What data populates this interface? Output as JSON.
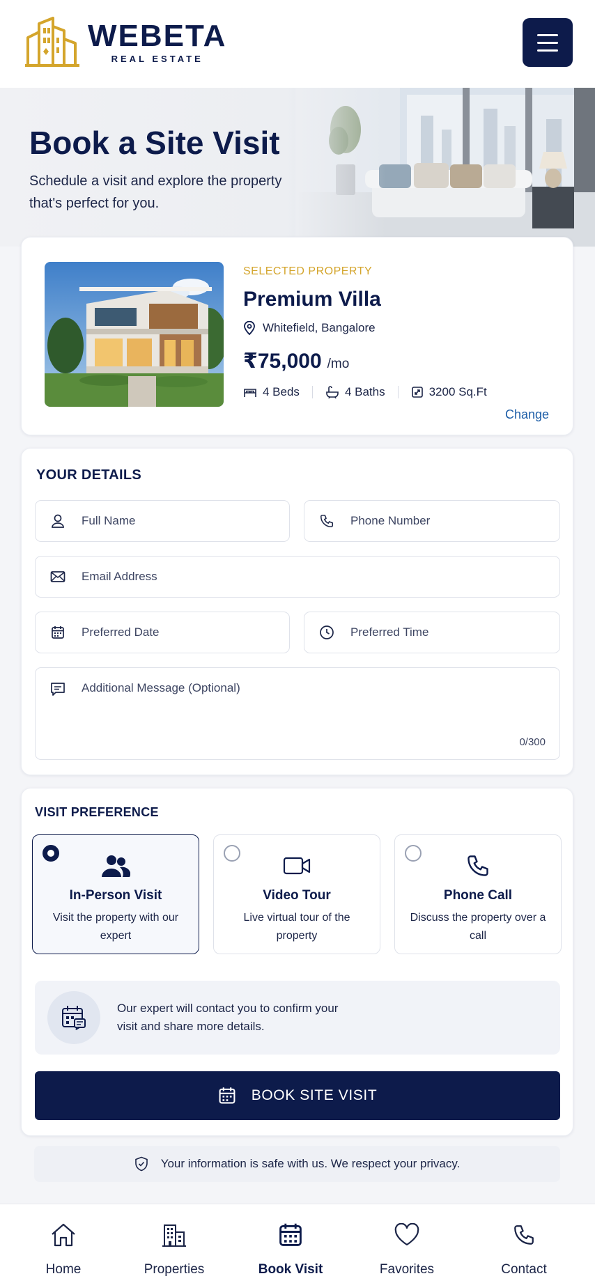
{
  "header": {
    "brand": "WEBETA",
    "brand_sub": "REAL ESTATE",
    "menu_icon": "hamburger-menu-icon"
  },
  "hero": {
    "title": "Book a Site Visit",
    "subtitle": "Schedule a visit and explore the property that's perfect for you."
  },
  "property": {
    "label": "SELECTED PROPERTY",
    "name": "Premium Villa",
    "location": "Whitefield, Bangalore",
    "price": "₹75,000",
    "price_unit": "/mo",
    "beds": "4 Beds",
    "baths": "4 Baths",
    "area": "3200 Sq.Ft",
    "change_label": "Change"
  },
  "details": {
    "title": "YOUR DETAILS",
    "full_name_placeholder": "Full Name",
    "phone_placeholder": "Phone Number",
    "email_placeholder": "Email Address",
    "date_placeholder": "Preferred Date",
    "time_placeholder": "Preferred Time",
    "message_placeholder": "Additional Message (Optional)",
    "char_count": "0/300"
  },
  "preference": {
    "title": "VISIT PREFERENCE",
    "options": [
      {
        "title": "In-Person Visit",
        "desc": "Visit the property with our expert",
        "icon": "users-icon",
        "selected": true
      },
      {
        "title": "Video Tour",
        "desc": "Live virtual tour of the property",
        "icon": "video-camera-icon",
        "selected": false
      },
      {
        "title": "Phone Call",
        "desc": "Discuss the property over a call",
        "icon": "phone-icon",
        "selected": false
      }
    ],
    "info_text": "Our expert will contact you to confirm your visit and share more details.",
    "book_label": "BOOK SITE VISIT"
  },
  "privacy_text": "Your information is safe with us. We respect your privacy.",
  "nav": {
    "items": [
      {
        "label": "Home",
        "icon": "home-icon",
        "active": false
      },
      {
        "label": "Properties",
        "icon": "building-icon",
        "active": false
      },
      {
        "label": "Book Visit",
        "icon": "calendar-icon",
        "active": true
      },
      {
        "label": "Favorites",
        "icon": "heart-icon",
        "active": false
      },
      {
        "label": "Contact",
        "icon": "phone-icon",
        "active": false
      }
    ]
  },
  "colors": {
    "navy": "#0d1b4b",
    "gold": "#d4a52c",
    "link": "#1f5fa8"
  }
}
